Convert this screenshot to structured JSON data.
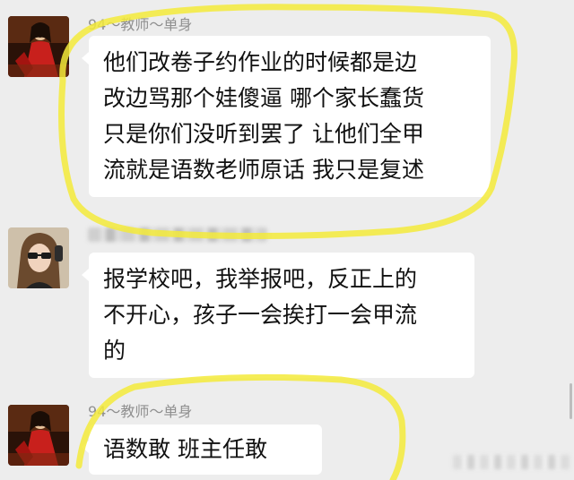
{
  "messages": [
    {
      "sender": "94～教师～单身",
      "lines": [
        "他们改卷子约作业的时候都是边",
        "改边骂那个娃傻逼 哪个家长蠢货",
        "只是你们没听到罢了 让他们全甲",
        "流就是语数老师原话 我只是复述"
      ]
    },
    {
      "sender": "",
      "lines": [
        "报学校吧，我举报吧，反正上的",
        "不开心，孩子一会挨打一会甲流",
        "的"
      ]
    },
    {
      "sender": "94～教师～单身",
      "lines": [
        "语数敢 班主任敢"
      ]
    }
  ],
  "colors": {
    "background": "#ededed",
    "bubble": "#ffffff",
    "highlight": "#f3ea3a",
    "sender_text": "#8f8f8f",
    "message_text": "#111111"
  }
}
